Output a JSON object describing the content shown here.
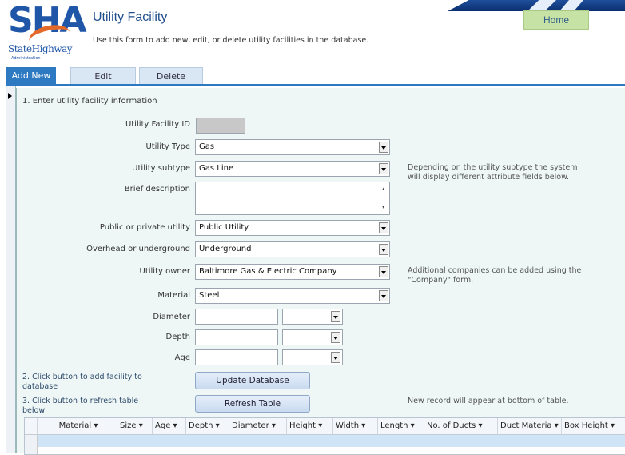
{
  "header": {
    "logo": {
      "text": "SHA",
      "subtitle": "StateHighway",
      "small": "Administration"
    },
    "title": "Utility Facility",
    "subtitle": "Use this form to add new, edit, or delete utility facilities in the database.",
    "home_label": "Home"
  },
  "tabs": [
    {
      "label": "Add New"
    },
    {
      "label": "Edit"
    },
    {
      "label": "Delete"
    }
  ],
  "form": {
    "section_title": "1. Enter utility facility information",
    "facility_id": {
      "label": "Utility Facility ID",
      "value": ""
    },
    "utility_type": {
      "label": "Utility Type",
      "value": "Gas"
    },
    "utility_subtype": {
      "label": "Utility subtype",
      "value": "Gas Line"
    },
    "brief_description": {
      "label": "Brief description",
      "value": ""
    },
    "public_private": {
      "label": "Public or private utility",
      "value": "Public Utility"
    },
    "overhead_underground": {
      "label": "Overhead or underground",
      "value": "Underground"
    },
    "utility_owner": {
      "label": "Utility owner",
      "value": "Baltimore Gas & Electric Company"
    },
    "material": {
      "label": "Material",
      "value": "Steel"
    },
    "diameter": {
      "label": "Diameter",
      "value": "",
      "unit": ""
    },
    "depth": {
      "label": "Depth",
      "value": "",
      "unit": ""
    },
    "age": {
      "label": "Age",
      "value": "",
      "unit": ""
    },
    "subtype_note": "Depending on the utility subtype the system will display different attribute fields below.",
    "owner_note": "Additional companies can be added using the \"Company\" form.",
    "step2": "2. Click button to add facility to database",
    "step3": "3. Click button to refresh table below",
    "update_button": "Update Database",
    "refresh_button": "Refresh Table",
    "table_note": "New record will appear at bottom of table."
  },
  "table": {
    "columns": [
      "Material",
      "Size",
      "Age",
      "Depth",
      "Diameter",
      "Height",
      "Width",
      "Length",
      "No. of Ducts",
      "Duct Materia",
      "Box Height"
    ]
  }
}
